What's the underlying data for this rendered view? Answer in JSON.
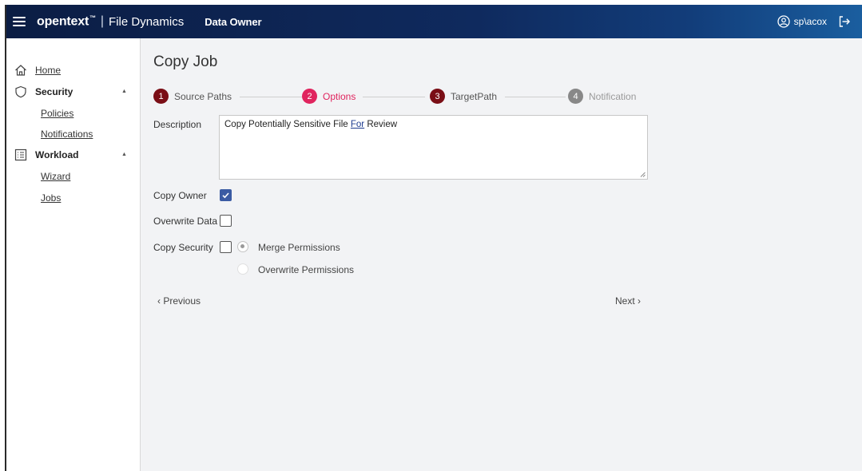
{
  "header": {
    "brand": "opentext",
    "brand_tm": "™",
    "separator": "|",
    "product": "File Dynamics",
    "context": "Data Owner",
    "username": "sp\\acox"
  },
  "sidebar": {
    "home": "Home",
    "security": "Security",
    "policies": "Policies",
    "notifications": "Notifications",
    "workload": "Workload",
    "wizard": "Wizard",
    "jobs": "Jobs",
    "caret": "▲"
  },
  "main": {
    "title": "Copy Job",
    "steps": [
      {
        "num": "1",
        "label": "Source Paths",
        "color": "#7a0e16",
        "label_color": "#555555"
      },
      {
        "num": "2",
        "label": "Options",
        "color": "#e0245e",
        "label_color": "#e0245e"
      },
      {
        "num": "3",
        "label": "TargetPath",
        "color": "#7a0e16",
        "label_color": "#555555"
      },
      {
        "num": "4",
        "label": "Notification",
        "color": "#888888",
        "label_color": "#9a9a9a"
      }
    ],
    "description_label": "Description",
    "description_value_pre": "Copy Potentially Sensitive File ",
    "description_value_link": "For",
    "description_value_post": " Review",
    "copy_owner_label": "Copy Owner",
    "copy_owner_checked": true,
    "overwrite_data_label": "Overwrite Data",
    "overwrite_data_checked": false,
    "copy_security_label": "Copy Security",
    "copy_security_checked": false,
    "merge_permissions_label": "Merge Permissions",
    "overwrite_permissions_label": "Overwrite Permissions",
    "previous_label": "‹ Previous",
    "next_label": "Next ›"
  },
  "colors": {
    "accent": "#3b5ba3",
    "active_step": "#e0245e",
    "completed_step": "#7a0e16"
  }
}
